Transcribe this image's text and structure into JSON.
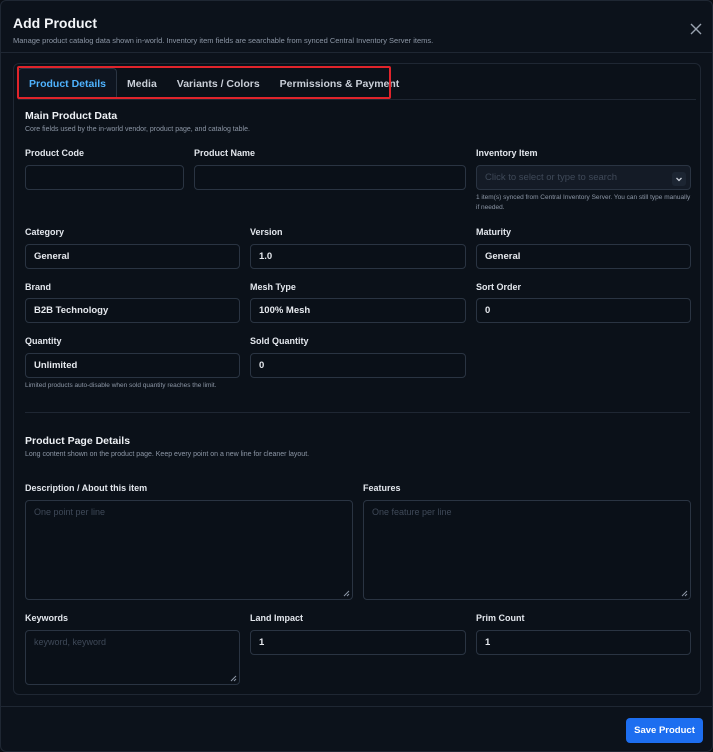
{
  "modal": {
    "title": "Add Product",
    "subtitle": "Manage product catalog data shown in-world. Inventory item fields are searchable from synced Central Inventory Server items.",
    "close_icon": "close-icon"
  },
  "tabs": [
    {
      "label": "Product Details",
      "active": true
    },
    {
      "label": "Media",
      "active": false
    },
    {
      "label": "Variants / Colors",
      "active": false
    },
    {
      "label": "Permissions & Payment",
      "active": false
    }
  ],
  "main_section": {
    "title": "Main Product Data",
    "desc": "Core fields used by the in-world vendor, product page, and catalog table."
  },
  "fields": {
    "product_code": {
      "label": "Product Code",
      "value": ""
    },
    "product_name": {
      "label": "Product Name",
      "value": ""
    },
    "inventory_item": {
      "label": "Inventory Item",
      "placeholder": "Click to select or type to search",
      "help": "1 item(s) synced from Central Inventory Server. You can still type manually if needed."
    },
    "category": {
      "label": "Category",
      "value": "General"
    },
    "version": {
      "label": "Version",
      "value": "1.0"
    },
    "maturity": {
      "label": "Maturity",
      "value": "General"
    },
    "brand": {
      "label": "Brand",
      "value": "B2B Technology"
    },
    "mesh_type": {
      "label": "Mesh Type",
      "value": "100% Mesh"
    },
    "sort_order": {
      "label": "Sort Order",
      "value": "0"
    },
    "quantity": {
      "label": "Quantity",
      "value": "Unlimited",
      "help": "Limited products auto-disable when sold quantity reaches the limit."
    },
    "sold_quantity": {
      "label": "Sold Quantity",
      "value": "0"
    }
  },
  "page_section": {
    "title": "Product Page Details",
    "desc": "Long content shown on the product page. Keep every point on a new line for cleaner layout."
  },
  "page_fields": {
    "description": {
      "label": "Description / About this item",
      "placeholder": "One point per line"
    },
    "features": {
      "label": "Features",
      "placeholder": "One feature per line"
    },
    "keywords": {
      "label": "Keywords",
      "placeholder": "keyword, keyword"
    },
    "land_impact": {
      "label": "Land Impact",
      "value": "1"
    },
    "prim_count": {
      "label": "Prim Count",
      "value": "1"
    }
  },
  "footer": {
    "save_label": "Save Product",
    "accent_color": "#1d6ef0"
  }
}
